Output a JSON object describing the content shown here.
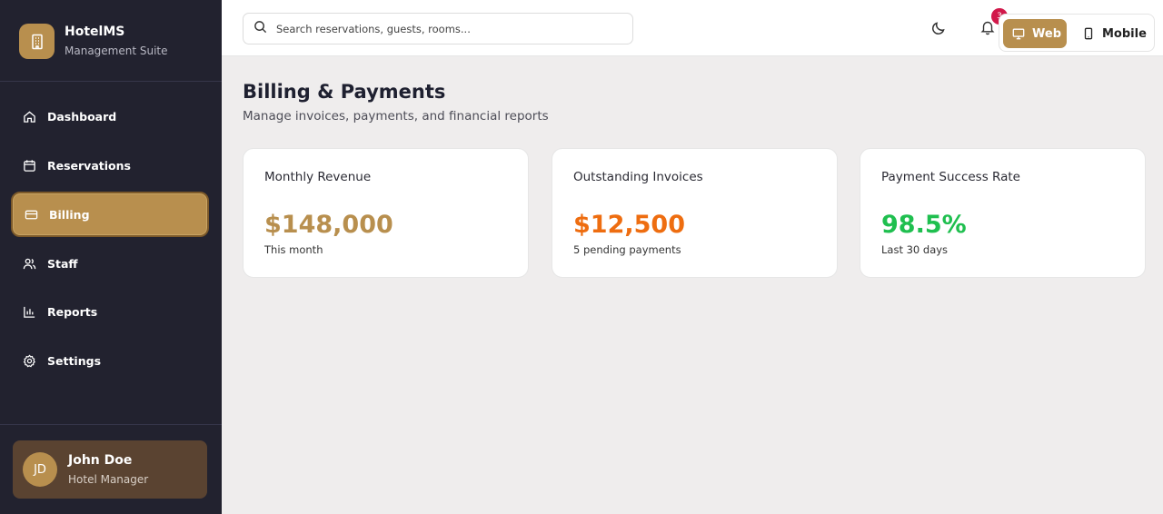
{
  "brand": {
    "title": "HotelMS",
    "subtitle": "Management Suite"
  },
  "nav": [
    {
      "label": "Dashboard",
      "icon": "home-icon"
    },
    {
      "label": "Reservations",
      "icon": "calendar-icon"
    },
    {
      "label": "Billing",
      "icon": "credit-card-icon",
      "active": true
    },
    {
      "label": "Staff",
      "icon": "users-icon"
    },
    {
      "label": "Reports",
      "icon": "bar-chart-icon"
    },
    {
      "label": "Settings",
      "icon": "gear-icon"
    }
  ],
  "user": {
    "initials": "JD",
    "name": "John Doe",
    "role": "Hotel Manager"
  },
  "topbar": {
    "search_placeholder": "Search reservations, guests, rooms...",
    "notification_count": "3",
    "mode_web": "Web",
    "mode_mobile": "Mobile"
  },
  "page": {
    "title": "Billing & Payments",
    "subtitle": "Manage invoices, payments, and financial reports"
  },
  "cards": [
    {
      "title": "Monthly Revenue",
      "value": "$148,000",
      "note": "This month",
      "color": "#b88f4e"
    },
    {
      "title": "Outstanding Invoices",
      "value": "$12,500",
      "note": "5 pending payments",
      "color": "#ee6d10"
    },
    {
      "title": "Payment Success Rate",
      "value": "98.5%",
      "note": "Last 30 days",
      "color": "#1fbf4f"
    }
  ],
  "colors": {
    "accent": "#b88f4e",
    "sidebar": "#22222f",
    "badge": "#d1184a"
  }
}
